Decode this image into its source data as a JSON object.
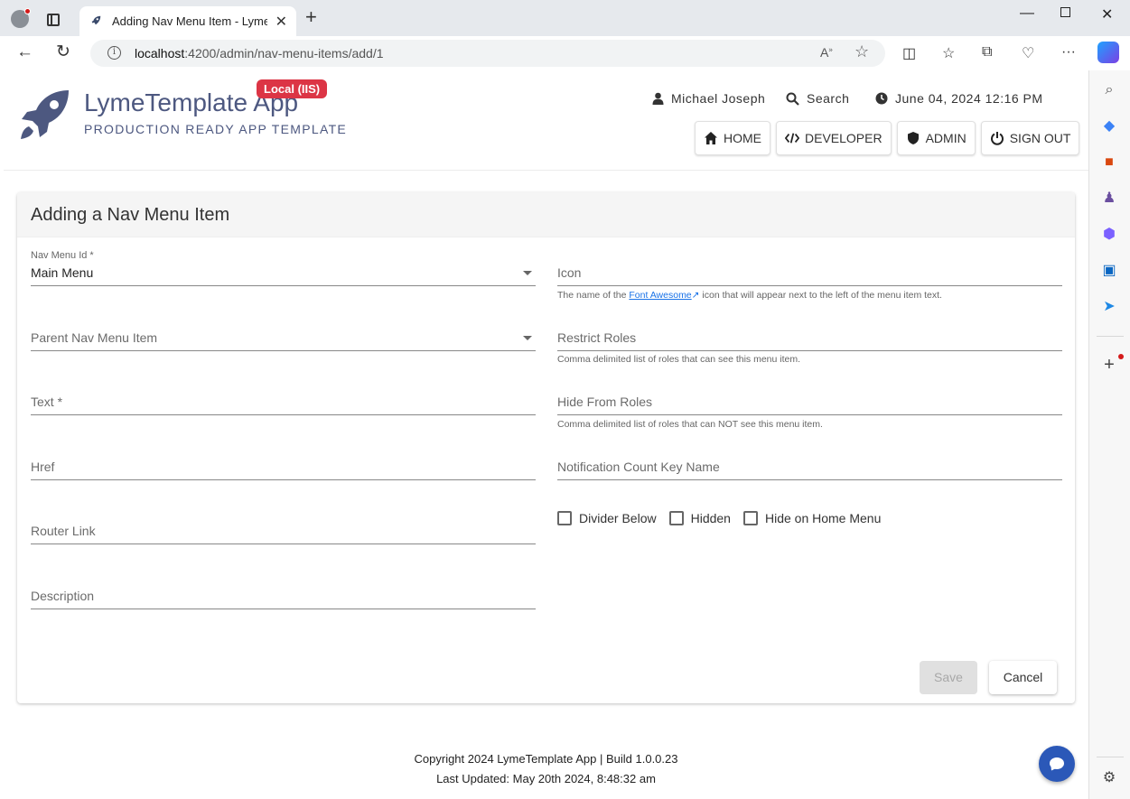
{
  "browser": {
    "tab_title": "Adding Nav Menu Item - LymeTe",
    "url_host": "localhost",
    "url_path": ":4200/admin/nav-menu-items/add/1"
  },
  "app": {
    "name": "LymeTemplate App",
    "tagline": "PRODUCTION READY APP TEMPLATE",
    "env_badge": "Local (IIS)",
    "accent_color": "#4d5880",
    "badge_color": "#dc3545"
  },
  "header": {
    "user_name": "Michael Joseph",
    "search_label": "Search",
    "datetime": "June 04, 2024 12:16 PM",
    "nav": [
      {
        "label": "HOME",
        "icon": "home-icon"
      },
      {
        "label": "DEVELOPER",
        "icon": "code-icon"
      },
      {
        "label": "ADMIN",
        "icon": "shield-icon"
      },
      {
        "label": "SIGN OUT",
        "icon": "power-icon"
      }
    ]
  },
  "form": {
    "title": "Adding a Nav Menu Item",
    "nav_menu_id": {
      "label": "Nav Menu Id *",
      "value": "Main Menu"
    },
    "parent_nav_menu_item": {
      "placeholder": "Parent Nav Menu Item"
    },
    "text": {
      "placeholder": "Text *"
    },
    "href": {
      "placeholder": "Href"
    },
    "router_link": {
      "placeholder": "Router Link"
    },
    "description": {
      "placeholder": "Description"
    },
    "icon": {
      "placeholder": "Icon",
      "hint_before": "The name of the",
      "hint_link": "Font Awesome",
      "hint_after": "icon that will appear next to the left of the menu item text."
    },
    "restrict_roles": {
      "placeholder": "Restrict Roles",
      "hint": "Comma delimited list of roles that can see this menu item."
    },
    "hide_from_roles": {
      "placeholder": "Hide From Roles",
      "hint": "Comma delimited list of roles that can NOT see this menu item."
    },
    "notification_count_key_name": {
      "placeholder": "Notification Count Key Name"
    },
    "checkboxes": [
      {
        "label": "Divider Below",
        "checked": false
      },
      {
        "label": "Hidden",
        "checked": false
      },
      {
        "label": "Hide on Home Menu",
        "checked": false
      }
    ],
    "save_label": "Save",
    "cancel_label": "Cancel"
  },
  "footer": {
    "copyright": "Copyright 2024 LymeTemplate App | Build 1.0.0.23",
    "last_updated": "Last Updated: May 20th 2024, 8:48:32 am"
  }
}
